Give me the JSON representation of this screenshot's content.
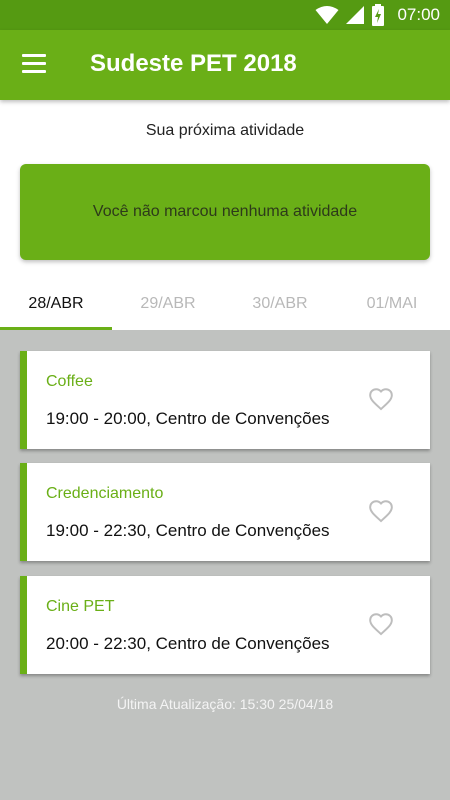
{
  "status_bar": {
    "time": "07:00"
  },
  "app_bar": {
    "title": "Sudeste PET 2018"
  },
  "next_activity": {
    "label": "Sua próxima atividade",
    "empty_message": "Você não marcou nenhuma atividade"
  },
  "tabs": [
    {
      "label": "28/ABR",
      "active": true
    },
    {
      "label": "29/ABR",
      "active": false
    },
    {
      "label": "30/ABR",
      "active": false
    },
    {
      "label": "01/MAI",
      "active": false
    }
  ],
  "events": [
    {
      "name": "Coffee",
      "details": "19:00 - 20:00, Centro de Convenções"
    },
    {
      "name": "Credenciamento",
      "details": "19:00 - 22:30, Centro de Convenções"
    },
    {
      "name": "Cine PET",
      "details": "20:00 - 22:30, Centro de Convenções"
    }
  ],
  "last_update": "Última Atualização: 15:30 25/04/18",
  "colors": {
    "primary": "#6aaf17",
    "status_bar": "#559a12",
    "list_background": "#c0c2c0"
  },
  "icons": {
    "wifi": "wifi-icon",
    "signal": "signal-icon",
    "battery": "battery-charging-icon",
    "menu": "menu-icon",
    "favorite": "heart-outline-icon"
  }
}
